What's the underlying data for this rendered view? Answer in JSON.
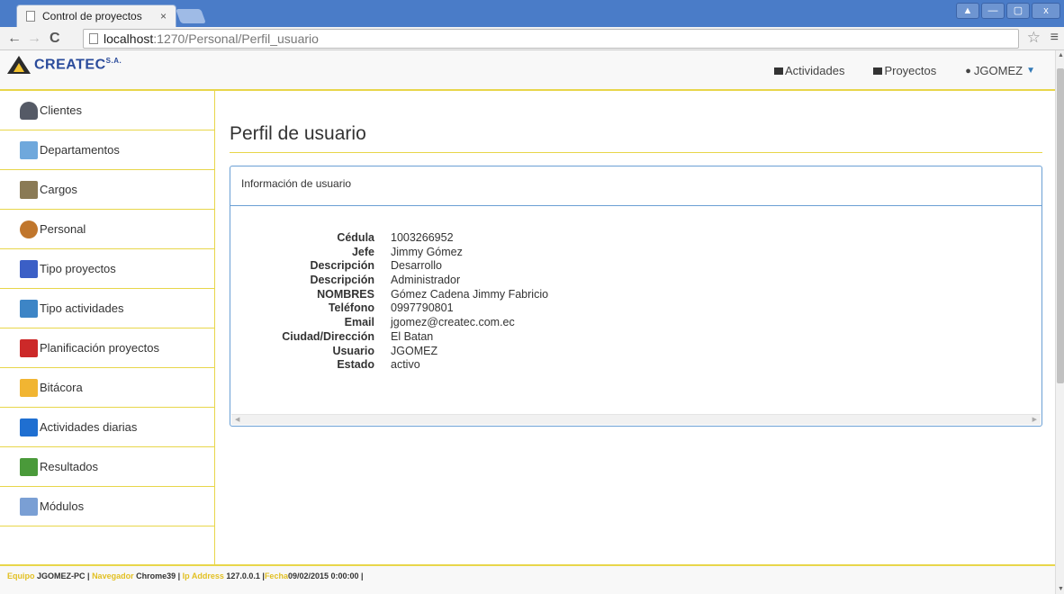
{
  "browser": {
    "tab_title": "Control de proyectos",
    "tab_close": "×",
    "url_host": "localhost",
    "url_path": ":1270/Personal/Perfil_usuario",
    "window_controls": [
      "▲",
      "—",
      "▢",
      "x"
    ]
  },
  "navbar": {
    "brand_name": "CREATEC",
    "brand_suffix": "S.A.",
    "items": [
      {
        "label": "Actividades",
        "icon": "tasks-icon"
      },
      {
        "label": "Proyectos",
        "icon": "folder-icon"
      },
      {
        "label": "JGOMEZ",
        "icon": "user-icon"
      }
    ]
  },
  "sidebar": {
    "items": [
      {
        "label": "Clientes",
        "icon": "client-icon",
        "color": "#555a66"
      },
      {
        "label": "Departamentos",
        "icon": "home-icon",
        "color": "#6fa8dc"
      },
      {
        "label": "Cargos",
        "icon": "clipboard-icon",
        "color": "#8a7a55"
      },
      {
        "label": "Personal",
        "icon": "people-icon",
        "color": "#c0762c"
      },
      {
        "label": "Tipo proyectos",
        "icon": "project-type-icon",
        "color": "#3b5fc6"
      },
      {
        "label": "Tipo actividades",
        "icon": "folder-blue-icon",
        "color": "#3d85c6"
      },
      {
        "label": "Planificación proyectos",
        "icon": "toolbox-icon",
        "color": "#cc2929"
      },
      {
        "label": "Bitácora",
        "icon": "folder-yellow-icon",
        "color": "#f1b532"
      },
      {
        "label": "Actividades diarias",
        "icon": "messenger-icon",
        "color": "#1f6fd1"
      },
      {
        "label": "Resultados",
        "icon": "spreadsheet-icon",
        "color": "#4a9a3a"
      },
      {
        "label": "Módulos",
        "icon": "pencil-icon",
        "color": "#7a9fd4"
      }
    ]
  },
  "main": {
    "page_title": "Perfil de usuario",
    "panel_heading": "Información de usuario",
    "fields": [
      {
        "key": "Cédula",
        "value": "1003266952"
      },
      {
        "key": "Jefe",
        "value": "Jimmy Gómez"
      },
      {
        "key": "Descripción",
        "value": "Desarrollo"
      },
      {
        "key": "Descripción",
        "value": "Administrador"
      },
      {
        "key": "NOMBRES",
        "value": "Gómez Cadena Jimmy Fabricio"
      },
      {
        "key": "Teléfono",
        "value": "0997790801"
      },
      {
        "key": "Email",
        "value": "jgomez@createc.com.ec"
      },
      {
        "key": "Ciudad/Dirección",
        "value": "El Batan"
      },
      {
        "key": "Usuario",
        "value": "JGOMEZ"
      },
      {
        "key": "Estado",
        "value": "activo"
      }
    ]
  },
  "footer": {
    "equipo_label": "Equipo",
    "equipo_value": "JGOMEZ-PC |",
    "navegador_label": "Navegador",
    "navegador_value": "Chrome39 |",
    "ip_label": "Ip Address",
    "ip_value": "127.0.0.1 |",
    "fecha_label": "Fecha",
    "fecha_value": "09/02/2015 0:00:00 |"
  },
  "colors": {
    "accent": "#e8d64a",
    "panel_border": "#6a9fd4",
    "brand": "#2a4b9b"
  }
}
